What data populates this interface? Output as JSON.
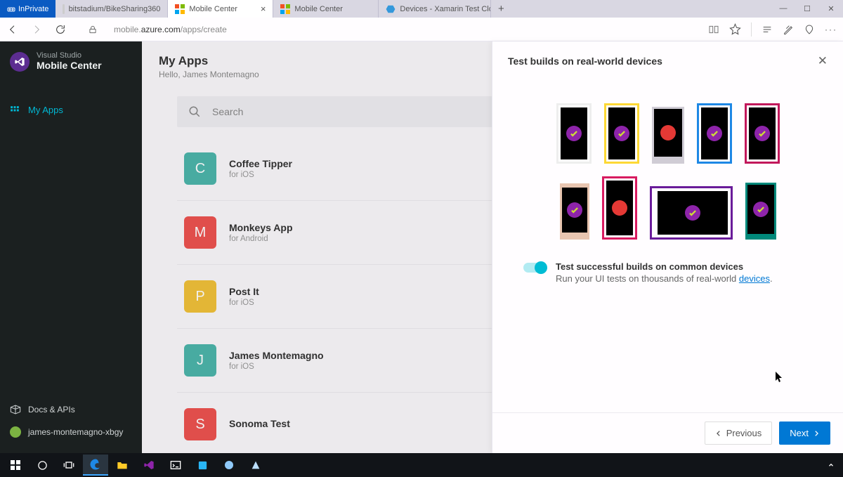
{
  "browser": {
    "inprivate_label": "InPrivate",
    "tabs": [
      {
        "label": "bitstadium/BikeSharing360"
      },
      {
        "label": "Mobile Center"
      },
      {
        "label": "Mobile Center"
      },
      {
        "label": "Devices - Xamarin Test Clou"
      }
    ],
    "url_prefix": "mobile.",
    "url_domain": "azure.com",
    "url_path": "/apps/create"
  },
  "sidebar": {
    "brand_line1": "Visual Studio",
    "brand_line2": "Mobile Center",
    "nav_my_apps": "My Apps",
    "docs_label": "Docs & APIs",
    "user_label": "james-montemagno-xbgy"
  },
  "main": {
    "title": "My Apps",
    "greeting": "Hello, James Montemagno",
    "search_placeholder": "Search",
    "apps": [
      {
        "letter": "C",
        "name": "Coffee Tipper",
        "platform": "for iOS",
        "color": "#4db6ac"
      },
      {
        "letter": "M",
        "name": "Monkeys App",
        "platform": "for Android",
        "color": "#ef5350"
      },
      {
        "letter": "P",
        "name": "Post It",
        "platform": "for iOS",
        "color": "#f2c23a"
      },
      {
        "letter": "J",
        "name": "James Montemagno",
        "platform": "for iOS",
        "color": "#4db6ac"
      },
      {
        "letter": "S",
        "name": "Sonoma Test",
        "platform": "",
        "color": "#ef5350"
      }
    ]
  },
  "panel": {
    "title": "Test builds on real-world devices",
    "toggle_title": "Test successful builds on common devices",
    "toggle_desc_prefix": "Run your UI tests on thousands of real-world ",
    "toggle_desc_link": "devices",
    "toggle_desc_suffix": ".",
    "prev_label": "Previous",
    "next_label": "Next"
  }
}
